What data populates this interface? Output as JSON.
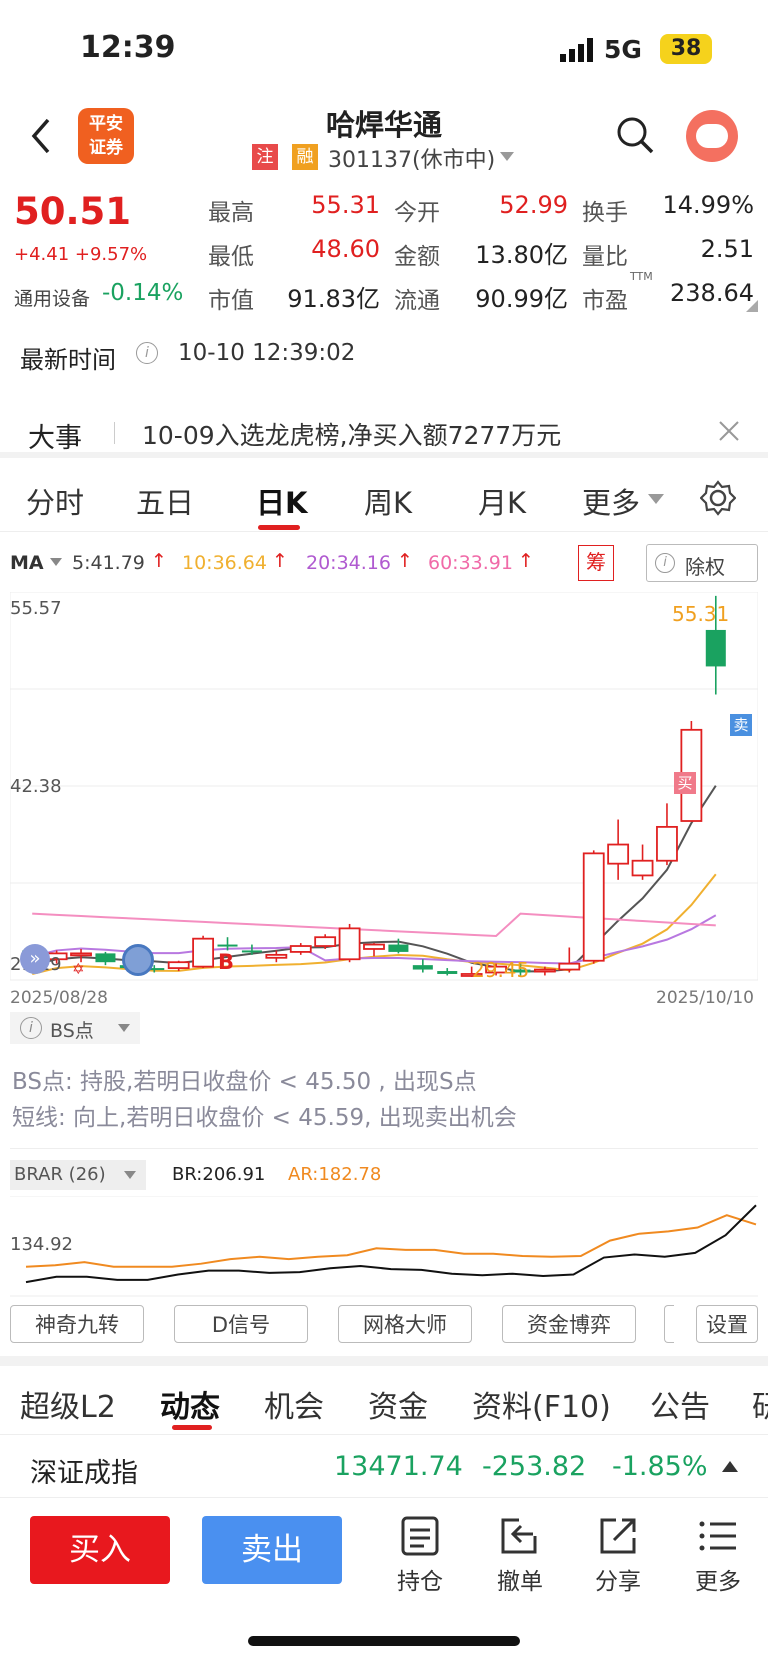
{
  "status": {
    "time": "12:39",
    "network": "5G",
    "battery": "38"
  },
  "header": {
    "title": "哈焊华通",
    "badge1": "注",
    "badge2": "融",
    "code": "301137(休市中)",
    "logo_line1": "平安",
    "logo_line2": "证券"
  },
  "quote": {
    "price": "50.51",
    "change": "+4.41 +9.57%",
    "sector": "通用设备",
    "sector_change": "-0.14%",
    "high_label": "最高",
    "high": "55.31",
    "open_label": "今开",
    "open": "52.99",
    "turnover_label": "换手",
    "turnover": "14.99%",
    "low_label": "最低",
    "low": "48.60",
    "amount_label": "金额",
    "amount": "13.80亿",
    "vol_ratio_label": "量比",
    "vol_ratio": "2.51",
    "mcap_label": "市值",
    "mcap": "91.83亿",
    "float_label": "流通",
    "float": "90.99亿",
    "pe_label": "市盈",
    "pe_ttm": "TTM",
    "pe": "238.64"
  },
  "update": {
    "label": "最新时间",
    "time": "10-10 12:39:02"
  },
  "event": {
    "label": "大事",
    "text": "10-09入选龙虎榜,净买入额7277万元"
  },
  "tabs": [
    "分时",
    "五日",
    "日K",
    "周K",
    "月K",
    "更多"
  ],
  "ma": {
    "label": "MA",
    "ma5": "5:41.79",
    "ma10": "10:36.64",
    "ma20": "20:34.16",
    "ma60": "60:33.91",
    "chip": "筹",
    "fq": "除权"
  },
  "chart": {
    "y_top": "55.57",
    "y_mid": "42.38",
    "y_bot": "29.19",
    "max_label": "55.31",
    "min_label": "29.45",
    "d_start": "2025/08/28",
    "d_end": "2025/10/10",
    "buy_mark": "买",
    "sell_mark": "卖",
    "b_mark": "B"
  },
  "chart_data": {
    "type": "candlestick",
    "x_range": [
      "2025/08/28",
      "2025/10/10"
    ],
    "ylim": [
      29.19,
      55.57
    ],
    "ohlc": [
      [
        31.2,
        31.5,
        30.0,
        30.2
      ],
      [
        30.6,
        31.2,
        30.3,
        31.0
      ],
      [
        31.0,
        31.3,
        30.4,
        31.0
      ],
      [
        31.0,
        31.1,
        30.2,
        30.4
      ],
      [
        30.2,
        30.4,
        29.8,
        30.0
      ],
      [
        30.0,
        30.2,
        29.7,
        29.9
      ],
      [
        30.0,
        30.5,
        29.8,
        30.4
      ],
      [
        30.1,
        32.2,
        30.0,
        32.0
      ],
      [
        31.6,
        32.1,
        31.2,
        31.5
      ],
      [
        31.2,
        31.6,
        30.9,
        31.1
      ],
      [
        30.7,
        31.2,
        30.4,
        30.9
      ],
      [
        31.1,
        31.7,
        30.9,
        31.5
      ],
      [
        31.5,
        32.3,
        31.3,
        32.1
      ],
      [
        30.6,
        33.0,
        30.4,
        32.7
      ],
      [
        31.3,
        31.7,
        30.8,
        31.6
      ],
      [
        31.6,
        32.0,
        31.0,
        31.1
      ],
      [
        30.2,
        30.6,
        29.7,
        29.9
      ],
      [
        29.8,
        30.0,
        29.5,
        29.6
      ],
      [
        29.6,
        30.1,
        29.4,
        29.6
      ],
      [
        29.7,
        30.3,
        29.5,
        30.1
      ],
      [
        29.9,
        30.4,
        29.45,
        29.7
      ],
      [
        29.8,
        30.1,
        29.5,
        29.9
      ],
      [
        29.9,
        31.4,
        29.7,
        30.3
      ],
      [
        30.5,
        38.0,
        30.3,
        37.8
      ],
      [
        37.1,
        40.1,
        36.0,
        38.4
      ],
      [
        36.3,
        38.4,
        36.0,
        37.3
      ],
      [
        37.3,
        41.2,
        37.0,
        39.6
      ],
      [
        40.0,
        46.8,
        40.0,
        46.2
      ],
      [
        52.99,
        55.31,
        48.6,
        50.51
      ]
    ],
    "series": [
      {
        "name": "MA5",
        "value": "41.79"
      },
      {
        "name": "MA10",
        "value": "36.64"
      },
      {
        "name": "MA20",
        "value": "34.16"
      },
      {
        "name": "MA60",
        "value": "33.91"
      }
    ]
  },
  "bs": {
    "label": "BS点",
    "line1": "BS点: 持股,若明日收盘价 < 45.50 , 出现S点",
    "line2": "短线: 向上,若明日收盘价 < 45.59, 出现卖出机会"
  },
  "brar": {
    "label": "BRAR (26)",
    "br": "BR:206.91",
    "ar": "AR:182.78",
    "y": "134.92",
    "br_values": [
      108,
      115,
      115,
      111,
      111,
      118,
      123,
      123,
      120,
      121,
      126,
      129,
      125,
      124,
      119,
      117,
      119,
      116,
      118,
      140,
      144,
      141,
      146,
      169,
      208
    ],
    "ar_values": [
      128,
      130,
      134,
      128,
      128,
      128,
      132,
      138,
      141,
      138,
      141,
      143,
      152,
      150,
      150,
      145,
      145,
      142,
      141,
      142,
      162,
      171,
      174,
      179,
      195,
      183
    ]
  },
  "tools": [
    "神奇九转",
    "D信号",
    "网格大师",
    "资金博弈",
    "设置"
  ],
  "bottom_tabs": [
    "超级L2",
    "动态",
    "机会",
    "资金",
    "资料(F10)",
    "公告",
    "研"
  ],
  "index": {
    "name": "深证成指",
    "value": "13471.74",
    "change": "-253.82",
    "pct": "-1.85%"
  },
  "actions": {
    "buy": "买入",
    "sell": "卖出",
    "hold": "持仓",
    "cancel": "撤单",
    "share": "分享",
    "more": "更多"
  },
  "colors": {
    "up": "#e02020",
    "down": "#1aa260",
    "ma5": "#555555",
    "ma10": "#f0b030",
    "ma20": "#b878e0",
    "ma60": "#f48ec0",
    "sell_btn": "#4a90f0"
  }
}
